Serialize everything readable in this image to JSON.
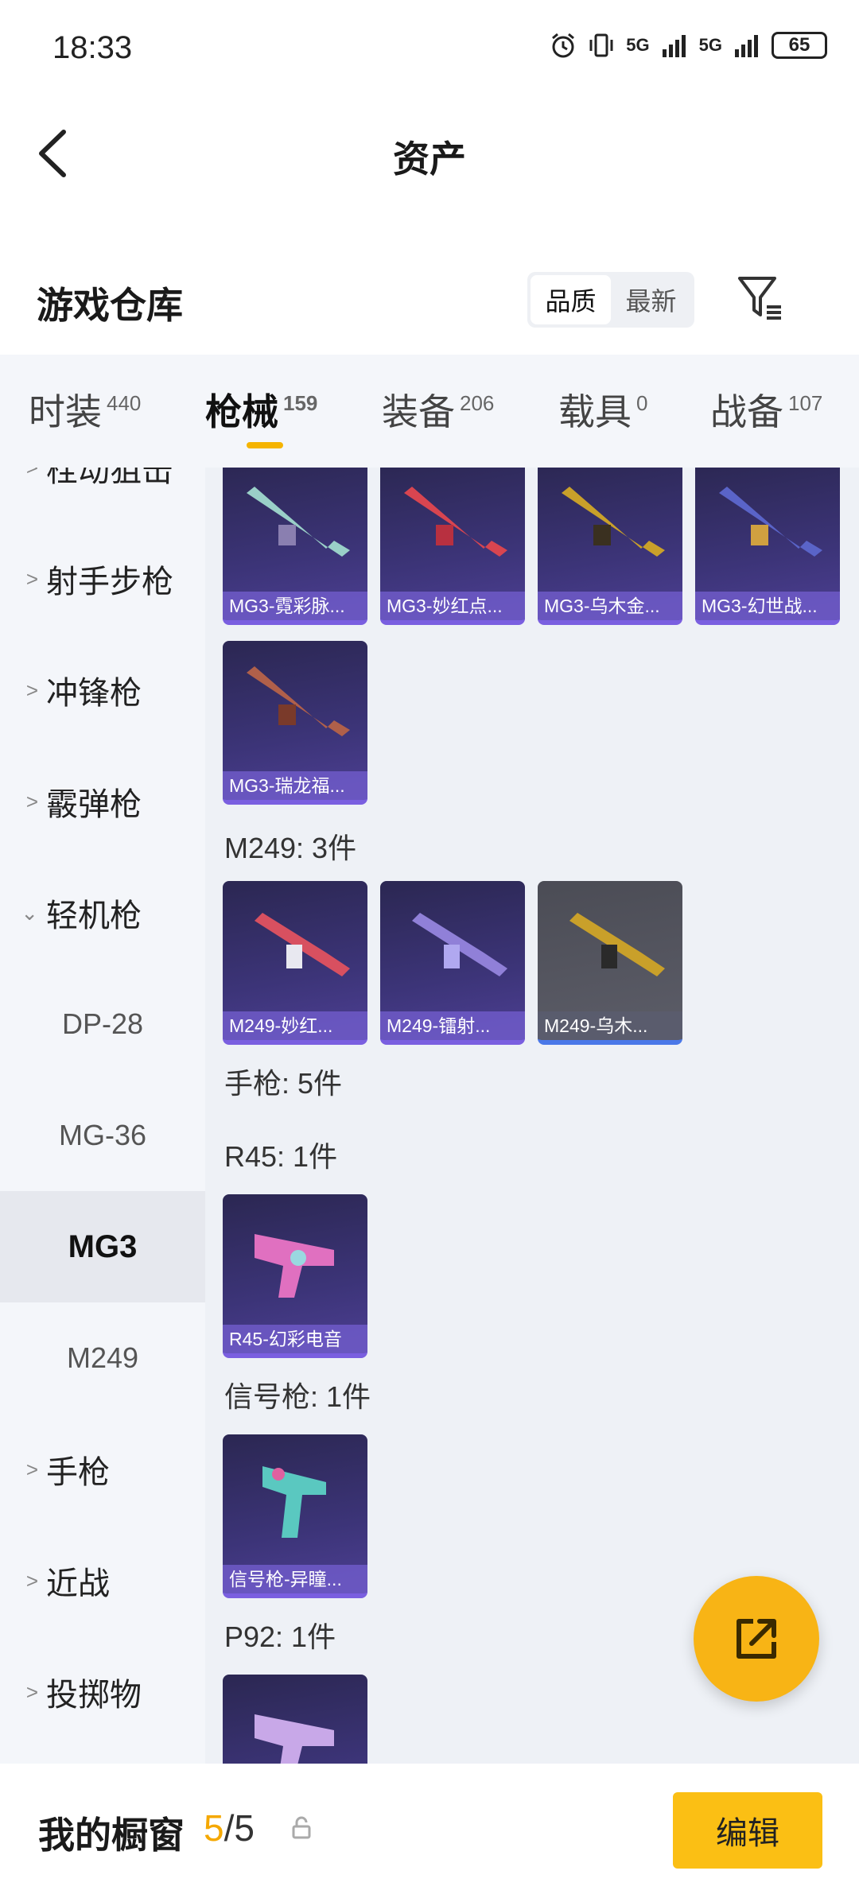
{
  "status_bar": {
    "time": "18:33",
    "net1": "5G",
    "net2": "5G",
    "battery": "65",
    "icons": [
      "alarm-icon",
      "vibrate-icon",
      "signal-icon",
      "signal-icon",
      "battery-icon"
    ]
  },
  "header": {
    "title": "资产"
  },
  "warehouse": {
    "title": "游戏仓库",
    "sort_options": [
      "品质",
      "最新"
    ],
    "sort_selected": "品质"
  },
  "tabs": [
    {
      "label": "时装",
      "count": "440"
    },
    {
      "label": "枪械",
      "count": "159"
    },
    {
      "label": "装备",
      "count": "206"
    },
    {
      "label": "载具",
      "count": "0"
    },
    {
      "label": "战备",
      "count": "107"
    }
  ],
  "active_tab": "枪械",
  "sidebar": {
    "categories": [
      {
        "label": "栓动狙击"
      },
      {
        "label": "射手步枪"
      },
      {
        "label": "冲锋枪"
      },
      {
        "label": "霰弹枪"
      },
      {
        "label": "轻机枪"
      }
    ],
    "sub_items": [
      "DP-28",
      "MG-36",
      "MG3",
      "M249"
    ],
    "active_sub": "MG3",
    "more_categories": [
      {
        "label": "手枪"
      },
      {
        "label": "近战"
      },
      {
        "label": "投掷物"
      }
    ]
  },
  "content": {
    "mg3_row1": [
      "MG3-霓彩脉...",
      "MG3-妙红点...",
      "MG3-乌木金...",
      "MG3-幻世战..."
    ],
    "mg3_row2": [
      "MG3-瑞龙福..."
    ],
    "m249_header": "M249: 3件",
    "m249_items": [
      "M249-妙红...",
      "M249-镭射...",
      "M249-乌木..."
    ],
    "pistol_header": "手枪: 5件",
    "r45_header": "R45: 1件",
    "r45_items": [
      "R45-幻彩电音"
    ],
    "flare_header": "信号枪: 1件",
    "flare_items": [
      "信号枪-异瞳..."
    ],
    "p92_header": "P92: 1件"
  },
  "bottom_bar": {
    "label": "我的橱窗",
    "current": "5",
    "separator": "/",
    "total": "5",
    "edit_label": "编辑"
  },
  "colors": {
    "accent": "#f5b400",
    "fab": "#f8b415",
    "card_purple": "#3c3478",
    "card_gray": "#5c5d68"
  }
}
